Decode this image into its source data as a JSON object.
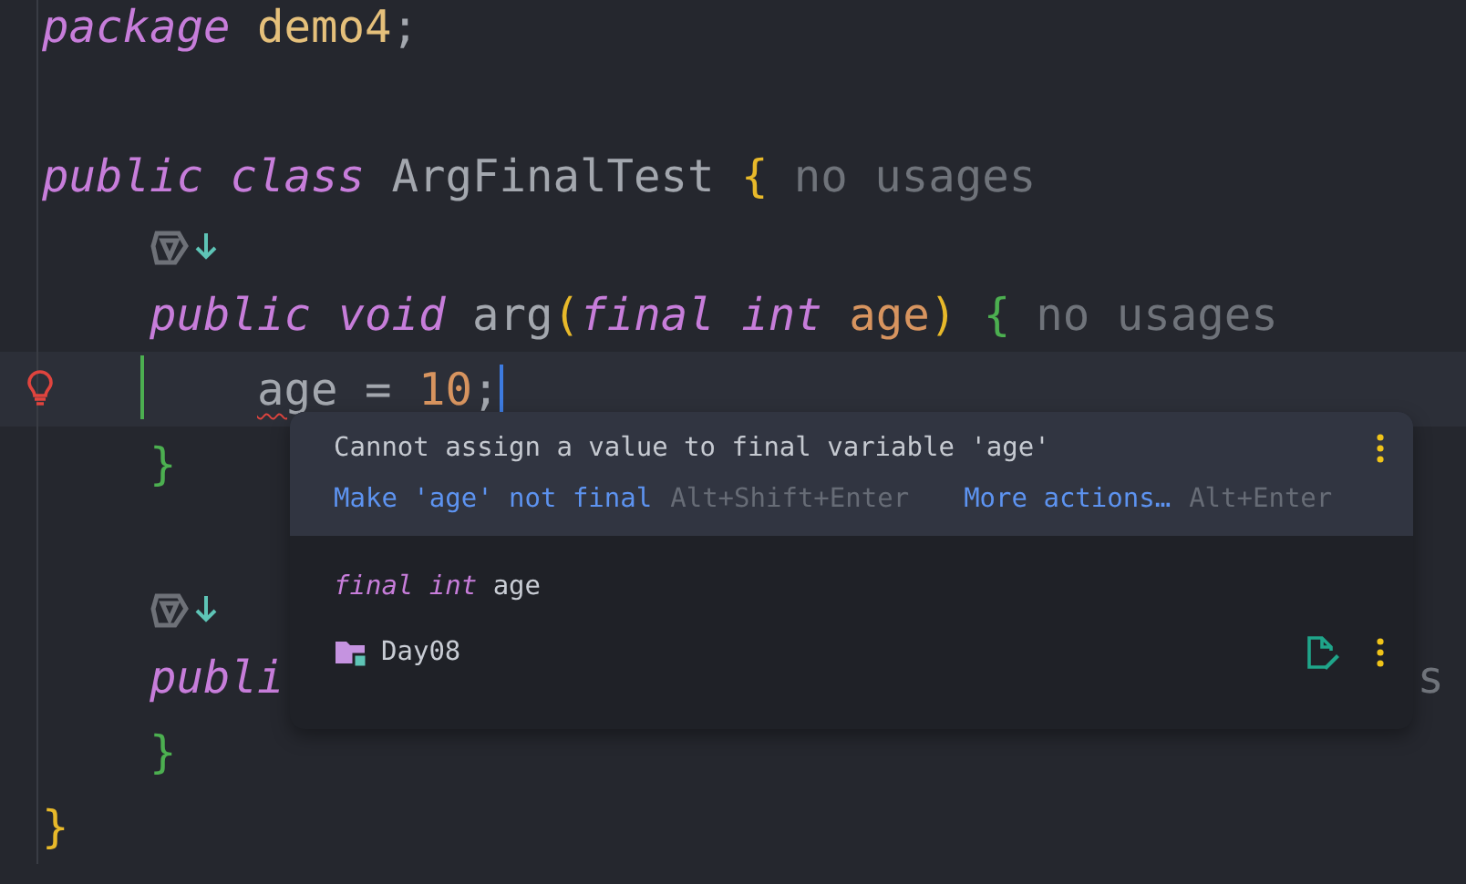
{
  "editor": {
    "lines": [
      {
        "kind": "code",
        "tokens": [
          {
            "text": "package ",
            "kind": "keyword"
          },
          {
            "text": "demo4",
            "kind": "package"
          },
          {
            "text": ";",
            "kind": "punct"
          }
        ]
      },
      {
        "kind": "blank"
      },
      {
        "kind": "code",
        "tokens": [
          {
            "text": "public ",
            "kind": "keyword"
          },
          {
            "text": "class ",
            "kind": "keyword"
          },
          {
            "text": "ArgFinalTest ",
            "kind": "ident"
          },
          {
            "text": "{",
            "kind": "brace1"
          }
        ],
        "hint": "no usages",
        "children": [
          {
            "kind": "inlay"
          },
          {
            "kind": "code",
            "tokens": [
              {
                "text": "public ",
                "kind": "keyword"
              },
              {
                "text": "void ",
                "kind": "keyword"
              },
              {
                "text": "arg",
                "kind": "ident"
              },
              {
                "text": "(",
                "kind": "brace1"
              },
              {
                "text": "final ",
                "kind": "keyword"
              },
              {
                "text": "int ",
                "kind": "keyword"
              },
              {
                "text": "age",
                "kind": "param"
              },
              {
                "text": ") ",
                "kind": "brace1"
              },
              {
                "text": "{",
                "kind": "brace2"
              }
            ],
            "hint": "no usages",
            "children": [
              {
                "kind": "code",
                "current": true,
                "bulb": true,
                "changed": true,
                "caret": true,
                "tokens": [
                  {
                    "text": "age",
                    "kind": "ident",
                    "error": true
                  },
                  {
                    "text": " = ",
                    "kind": "punct"
                  },
                  {
                    "text": "10",
                    "kind": "number"
                  },
                  {
                    "text": ";",
                    "kind": "punct"
                  }
                ]
              }
            ]
          },
          {
            "kind": "code",
            "tokens": [
              {
                "text": "}",
                "kind": "brace2"
              }
            ]
          },
          {
            "kind": "blank"
          },
          {
            "kind": "inlay"
          },
          {
            "kind": "code",
            "tokens": [
              {
                "text": "publi",
                "kind": "keyword"
              }
            ],
            "tail": "s"
          },
          {
            "kind": "code",
            "tokens": [
              {
                "text": "}",
                "kind": "brace2"
              }
            ]
          }
        ]
      },
      {
        "kind": "code",
        "tokens": [
          {
            "text": "}",
            "kind": "brace1"
          }
        ]
      }
    ]
  },
  "popup": {
    "message": "Cannot assign a value to final variable 'age'",
    "actions": [
      {
        "label": "Make 'age' not final",
        "shortcut": "Alt+Shift+Enter"
      },
      {
        "label": "More actions…",
        "shortcut": "Alt+Enter"
      }
    ],
    "declaration": [
      {
        "text": "final ",
        "kind": "keyword"
      },
      {
        "text": "int ",
        "kind": "keyword"
      },
      {
        "text": "age",
        "kind": "plain"
      }
    ],
    "location": "Day08"
  }
}
